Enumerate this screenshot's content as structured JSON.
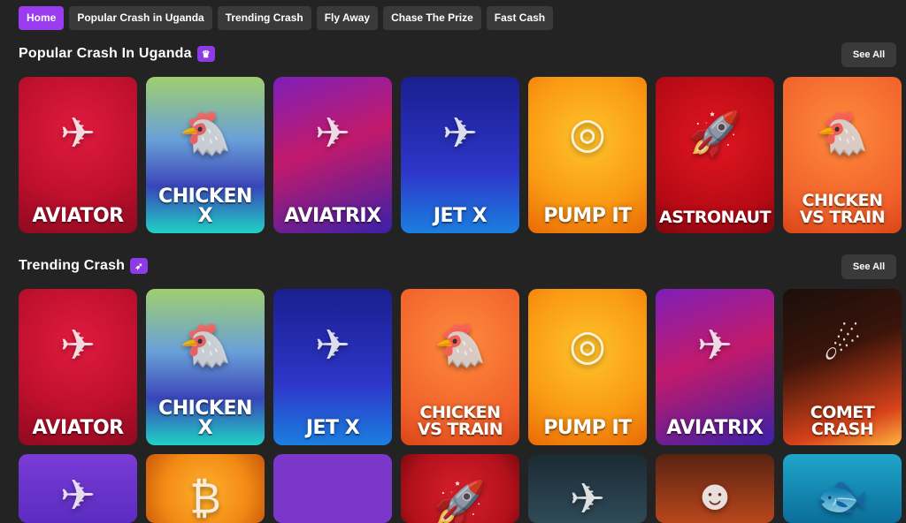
{
  "tabs": [
    "Home",
    "Popular Crash in Uganda",
    "Trending Crash",
    "Fly Away",
    "Chase The Prize",
    "Fast Cash"
  ],
  "active_tab": "Home",
  "sections": [
    {
      "title": "Popular Crash In Uganda",
      "badge_icon": "trophy-icon",
      "see_all": "See All",
      "games": [
        {
          "name": "AVIATOR",
          "icon": "airplane-icon",
          "theme": "aviator"
        },
        {
          "name": "CHICKEN\nX",
          "icon": "chicken-icon",
          "theme": "chicken"
        },
        {
          "name": "AVIATRIX",
          "icon": "jet-icon",
          "theme": "aviatrix"
        },
        {
          "name": "JET X",
          "icon": "jet-icon",
          "theme": "jetx"
        },
        {
          "name": "PUMP IT",
          "icon": "wheel-icon",
          "theme": "pump"
        },
        {
          "name": "ASTRONAUT",
          "icon": "rocket-icon",
          "theme": "astro"
        },
        {
          "name": "CHICKEN\nVS TRAIN",
          "icon": "chicken-icon",
          "theme": "cvt"
        }
      ]
    },
    {
      "title": "Trending Crash",
      "badge_icon": "rocket-icon",
      "see_all": "See All",
      "games": [
        {
          "name": "AVIATOR",
          "icon": "airplane-icon",
          "theme": "aviator"
        },
        {
          "name": "CHICKEN\nX",
          "icon": "chicken-icon",
          "theme": "chicken"
        },
        {
          "name": "JET X",
          "icon": "jet-icon",
          "theme": "jetx"
        },
        {
          "name": "CHICKEN\nVS TRAIN",
          "icon": "chicken-icon",
          "theme": "cvt"
        },
        {
          "name": "PUMP IT",
          "icon": "wheel-icon",
          "theme": "pump"
        },
        {
          "name": "AVIATRIX",
          "icon": "jet-icon",
          "theme": "aviatrix"
        },
        {
          "name": "COMET\nCRASH",
          "icon": "comet-icon",
          "theme": "comet"
        }
      ]
    }
  ],
  "third_row": [
    {
      "icon": "biplane-icon",
      "theme": "plane"
    },
    {
      "icon": "bitcoin-icon",
      "theme": "btc"
    },
    {
      "icon": "",
      "theme": "purple"
    },
    {
      "icon": "rocket-icon",
      "theme": "rocket"
    },
    {
      "icon": "fighter-jet-icon",
      "theme": "fight"
    },
    {
      "icon": "boxer-icon",
      "theme": "boxer"
    },
    {
      "icon": "fish-icon",
      "theme": "fish"
    }
  ]
}
